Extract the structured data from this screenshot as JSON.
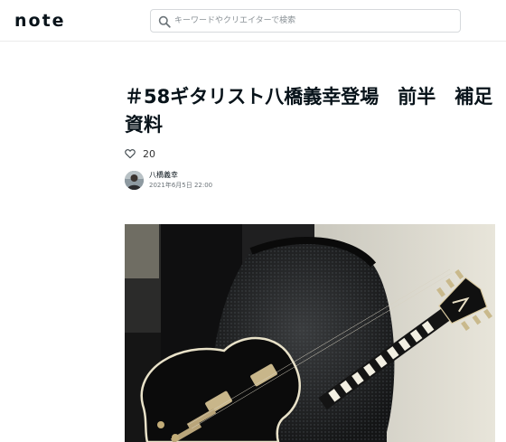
{
  "header": {
    "logo": "note",
    "search_placeholder": "キーワードやクリエイターで検索"
  },
  "article": {
    "title": "＃58ギタリスト八橋義幸登場　前半　補足資料",
    "likes": "20",
    "author": "八橋義幸",
    "date": "2021年6月5日 22:00"
  },
  "icons": {
    "search": "search-icon",
    "like": "heart-icon"
  }
}
